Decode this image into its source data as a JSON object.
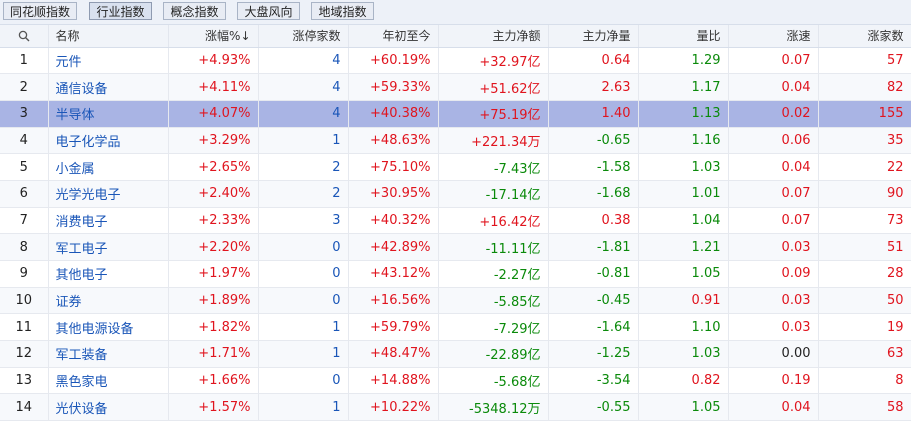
{
  "tabs": [
    {
      "label": "同花顺指数"
    },
    {
      "label": "行业指数"
    },
    {
      "label": "概念指数"
    },
    {
      "label": "大盘风向"
    },
    {
      "label": "地域指数"
    }
  ],
  "header": {
    "search_icon": "search-icon",
    "name": "名称",
    "change_pct": "涨幅%",
    "limit_up_count": "涨停家数",
    "ytd": "年初至今",
    "main_net_amount": "主力净额",
    "main_net_volume": "主力净量",
    "volume_ratio": "量比",
    "speed": "涨速",
    "up_count": "涨家数"
  },
  "sort_indicator": "↓",
  "selected_row_index": 2,
  "rows": [
    {
      "idx": "1",
      "name": "元件",
      "change": "+4.93%",
      "limit": "4",
      "ytd": "+60.19%",
      "main_amt": "+32.97亿",
      "main_vol": "0.64",
      "vol_ratio": "1.29",
      "speed": "0.07",
      "up": "57"
    },
    {
      "idx": "2",
      "name": "通信设备",
      "change": "+4.11%",
      "limit": "4",
      "ytd": "+59.33%",
      "main_amt": "+51.62亿",
      "main_vol": "2.63",
      "vol_ratio": "1.17",
      "speed": "0.04",
      "up": "82"
    },
    {
      "idx": "3",
      "name": "半导体",
      "change": "+4.07%",
      "limit": "4",
      "ytd": "+40.38%",
      "main_amt": "+75.19亿",
      "main_vol": "1.40",
      "vol_ratio": "1.13",
      "speed": "0.02",
      "up": "155"
    },
    {
      "idx": "4",
      "name": "电子化学品",
      "change": "+3.29%",
      "limit": "1",
      "ytd": "+48.63%",
      "main_amt": "+221.34万",
      "main_vol": "-0.65",
      "vol_ratio": "1.16",
      "speed": "0.06",
      "up": "35"
    },
    {
      "idx": "5",
      "name": "小金属",
      "change": "+2.65%",
      "limit": "2",
      "ytd": "+75.10%",
      "main_amt": "-7.43亿",
      "main_vol": "-1.58",
      "vol_ratio": "1.03",
      "speed": "0.04",
      "up": "22"
    },
    {
      "idx": "6",
      "name": "光学光电子",
      "change": "+2.40%",
      "limit": "2",
      "ytd": "+30.95%",
      "main_amt": "-17.14亿",
      "main_vol": "-1.68",
      "vol_ratio": "1.01",
      "speed": "0.07",
      "up": "90"
    },
    {
      "idx": "7",
      "name": "消费电子",
      "change": "+2.33%",
      "limit": "3",
      "ytd": "+40.32%",
      "main_amt": "+16.42亿",
      "main_vol": "0.38",
      "vol_ratio": "1.04",
      "speed": "0.07",
      "up": "73"
    },
    {
      "idx": "8",
      "name": "军工电子",
      "change": "+2.20%",
      "limit": "0",
      "ytd": "+42.89%",
      "main_amt": "-11.11亿",
      "main_vol": "-1.81",
      "vol_ratio": "1.21",
      "speed": "0.03",
      "up": "51"
    },
    {
      "idx": "9",
      "name": "其他电子",
      "change": "+1.97%",
      "limit": "0",
      "ytd": "+43.12%",
      "main_amt": "-2.27亿",
      "main_vol": "-0.81",
      "vol_ratio": "1.05",
      "speed": "0.09",
      "up": "28"
    },
    {
      "idx": "10",
      "name": "证券",
      "change": "+1.89%",
      "limit": "0",
      "ytd": "+16.56%",
      "main_amt": "-5.85亿",
      "main_vol": "-0.45",
      "vol_ratio": "0.91",
      "speed": "0.03",
      "up": "50"
    },
    {
      "idx": "11",
      "name": "其他电源设备",
      "change": "+1.82%",
      "limit": "1",
      "ytd": "+59.79%",
      "main_amt": "-7.29亿",
      "main_vol": "-1.64",
      "vol_ratio": "1.10",
      "speed": "0.03",
      "up": "19"
    },
    {
      "idx": "12",
      "name": "军工装备",
      "change": "+1.71%",
      "limit": "1",
      "ytd": "+48.47%",
      "main_amt": "-22.89亿",
      "main_vol": "-1.25",
      "vol_ratio": "1.03",
      "speed": "0.00",
      "up": "63"
    },
    {
      "idx": "13",
      "name": "黑色家电",
      "change": "+1.66%",
      "limit": "0",
      "ytd": "+14.88%",
      "main_amt": "-5.68亿",
      "main_vol": "-3.54",
      "vol_ratio": "0.82",
      "speed": "0.19",
      "up": "8"
    },
    {
      "idx": "14",
      "name": "光伏设备",
      "change": "+1.57%",
      "limit": "1",
      "ytd": "+10.22%",
      "main_amt": "-5348.12万",
      "main_vol": "-0.55",
      "vol_ratio": "1.05",
      "speed": "0.04",
      "up": "58"
    }
  ],
  "colors": {
    "up": "#e0141e",
    "down": "#0a8a0a",
    "neutral": "#222222",
    "link_blue": "#1a56b8",
    "selected_row": "#a9b4e4"
  }
}
